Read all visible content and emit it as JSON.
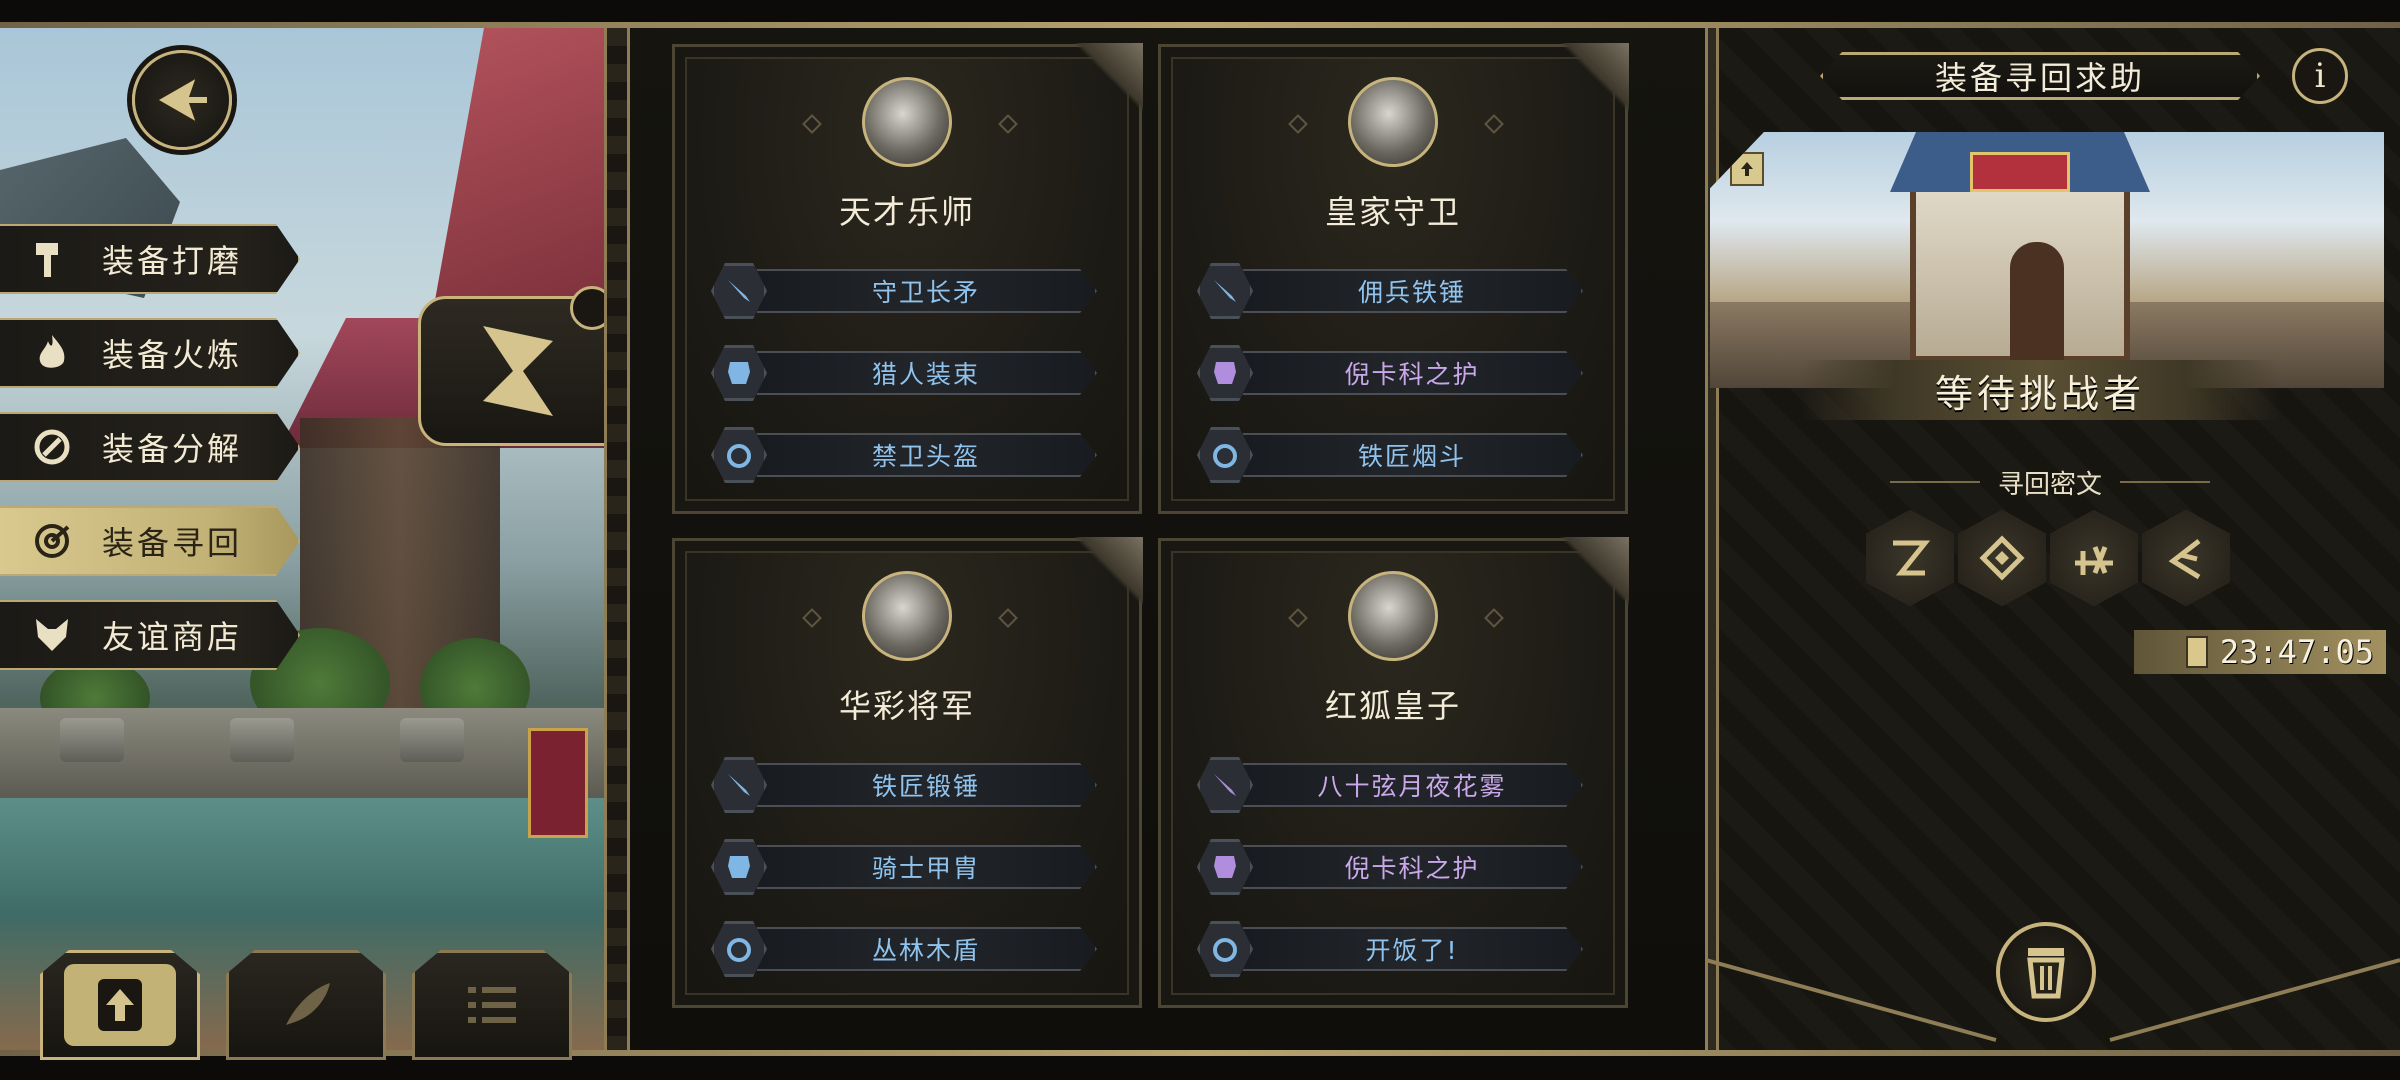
{
  "menu": {
    "items": [
      {
        "label": "装备打磨",
        "icon": "hammer-icon",
        "active": false
      },
      {
        "label": "装备火炼",
        "icon": "flame-icon",
        "active": false
      },
      {
        "label": "装备分解",
        "icon": "dismantle-icon",
        "active": false
      },
      {
        "label": "装备寻回",
        "icon": "target-icon",
        "active": true
      },
      {
        "label": "友谊商店",
        "icon": "fox-icon",
        "active": false
      }
    ]
  },
  "bottom_tabs": [
    {
      "icon": "upload-icon",
      "active": true
    },
    {
      "icon": "feather-icon",
      "active": false
    },
    {
      "icon": "list-icon",
      "active": false
    }
  ],
  "cards": [
    {
      "name": "天才乐师",
      "portrait": "dog-musician-portrait",
      "items": [
        {
          "slot": "weapon",
          "label": "守卫长矛",
          "rarity": "blue"
        },
        {
          "slot": "armor",
          "label": "猎人装束",
          "rarity": "blue"
        },
        {
          "slot": "accessory",
          "label": "禁卫头盔",
          "rarity": "blue"
        }
      ]
    },
    {
      "name": "皇家守卫",
      "portrait": "royal-guard-portrait",
      "items": [
        {
          "slot": "weapon",
          "label": "佣兵铁锤",
          "rarity": "blue"
        },
        {
          "slot": "armor",
          "label": "倪卡科之护",
          "rarity": "purple"
        },
        {
          "slot": "accessory",
          "label": "铁匠烟斗",
          "rarity": "blue"
        }
      ]
    },
    {
      "name": "华彩将军",
      "portrait": "general-portrait",
      "items": [
        {
          "slot": "weapon",
          "label": "铁匠锻锤",
          "rarity": "blue"
        },
        {
          "slot": "armor",
          "label": "骑士甲胄",
          "rarity": "blue"
        },
        {
          "slot": "accessory",
          "label": "丛林木盾",
          "rarity": "blue"
        }
      ]
    },
    {
      "name": "红狐皇子",
      "portrait": "fox-prince-portrait",
      "items": [
        {
          "slot": "weapon",
          "label": "八十弦月夜花雾",
          "rarity": "purple"
        },
        {
          "slot": "armor",
          "label": "倪卡科之护",
          "rarity": "purple"
        },
        {
          "slot": "accessory",
          "label": "开饭了!",
          "rarity": "blue"
        }
      ]
    }
  ],
  "right_panel": {
    "title": "装备寻回求助",
    "info_label": "i",
    "status": "等待挑战者",
    "cipher_heading": "寻回密文",
    "runes": [
      "rune-1-icon",
      "rune-2-icon",
      "rune-3-icon",
      "rune-4-icon"
    ],
    "timer": "23:47:05"
  },
  "colors": {
    "gold": "#c7b37c",
    "rarity_blue": "#8fc3ee",
    "rarity_purple": "#c9a8ea",
    "panel_bg": "#1c1a15"
  }
}
